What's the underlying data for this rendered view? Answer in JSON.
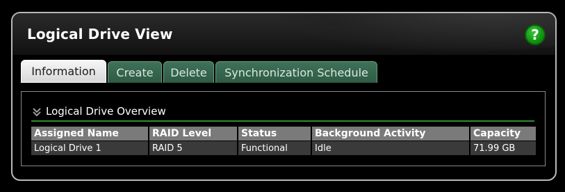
{
  "page": {
    "title": "Logical Drive View",
    "help_icon": "question-mark-icon",
    "help_glyph": "?",
    "accent_color": "#109a10"
  },
  "tabs": [
    {
      "label": "Information",
      "active": true
    },
    {
      "label": "Create",
      "active": false
    },
    {
      "label": "Delete",
      "active": false
    },
    {
      "label": "Synchronization Schedule",
      "active": false
    }
  ],
  "section": {
    "title": "Logical Drive Overview",
    "icon": "chevron-double-down-icon"
  },
  "table": {
    "columns": [
      "Assigned Name",
      "RAID Level",
      "Status",
      "Background Activity",
      "Capacity"
    ],
    "rows": [
      [
        "Logical Drive 1",
        "RAID 5",
        "Functional",
        "Idle",
        "71.99 GB"
      ]
    ]
  }
}
